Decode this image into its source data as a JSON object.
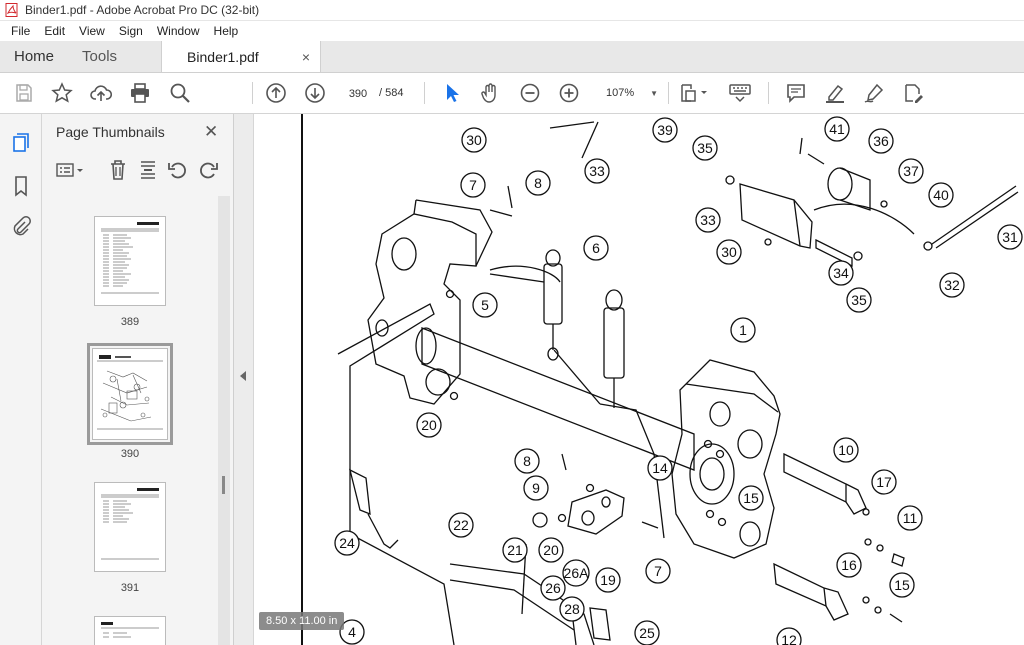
{
  "window": {
    "title": "Binder1.pdf - Adobe Acrobat Pro DC (32-bit)"
  },
  "menu": [
    "File",
    "Edit",
    "View",
    "Sign",
    "Window",
    "Help"
  ],
  "tabs": {
    "home": "Home",
    "tools": "Tools",
    "document": "Binder1.pdf",
    "close": "×"
  },
  "toolbar": {
    "page_current": "390",
    "page_total": "/   584",
    "zoom": "107%"
  },
  "panel": {
    "title": "Page Thumbnails",
    "close": "✕",
    "thumbnails": [
      {
        "label": "389"
      },
      {
        "label": "390"
      },
      {
        "label": "391"
      }
    ]
  },
  "viewer": {
    "page_size": "8.50 x 11.00 in",
    "callouts": [
      "30",
      "33",
      "39",
      "41",
      "36",
      "35",
      "37",
      "40",
      "7",
      "8",
      "33",
      "30",
      "34",
      "35",
      "32",
      "31",
      "6",
      "5",
      "1",
      "20",
      "10",
      "14",
      "17",
      "8",
      "9",
      "15",
      "11",
      "22",
      "21",
      "20",
      "26A",
      "19",
      "7",
      "16",
      "15",
      "24",
      "26",
      "28",
      "25",
      "4",
      "12"
    ]
  },
  "colors": {
    "accent": "#1a73e8",
    "toolbar_icon": "#555555",
    "acrobat_red": "#d2282e"
  }
}
